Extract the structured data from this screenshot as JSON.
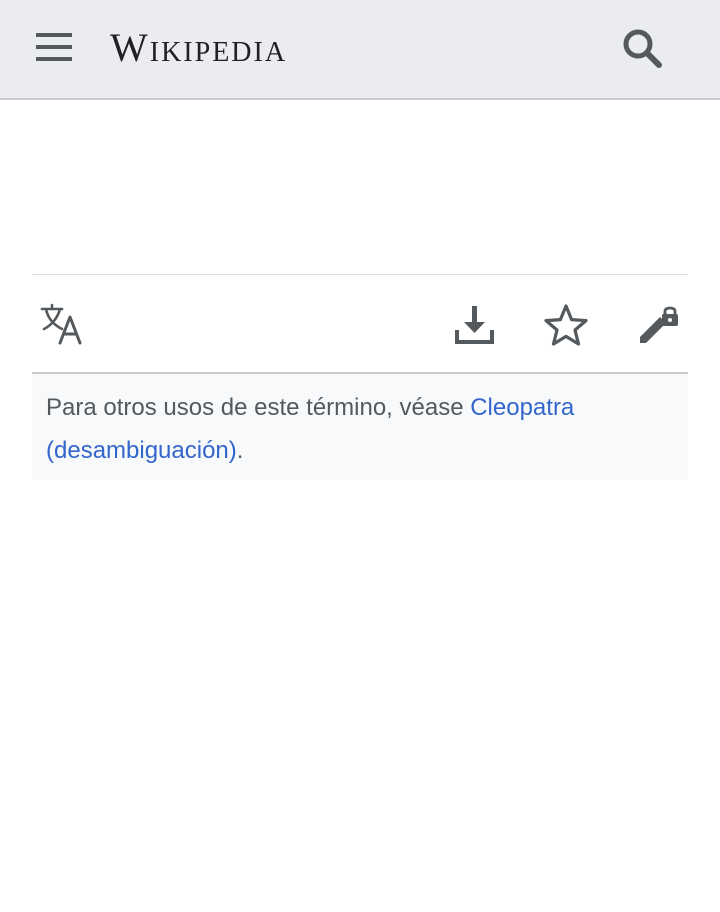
{
  "header": {
    "menu_icon": "hamburger-menu-icon",
    "logo_text": "Wikipedia",
    "search_icon": "search-icon"
  },
  "page_actions": {
    "language_icon": "language-icon",
    "download_icon": "download-icon",
    "watch_icon": "star-icon",
    "edit_icon": "edit-protected-icon"
  },
  "hatnote": {
    "text": "Para otros usos de este término, véase ",
    "link_text": "Cleopatra (desambiguación)",
    "suffix": "."
  },
  "colors": {
    "header_bg": "#eaecf0",
    "link": "#3366cc",
    "hatnote_bg": "#f8f9fa",
    "icon": "#54595d"
  }
}
